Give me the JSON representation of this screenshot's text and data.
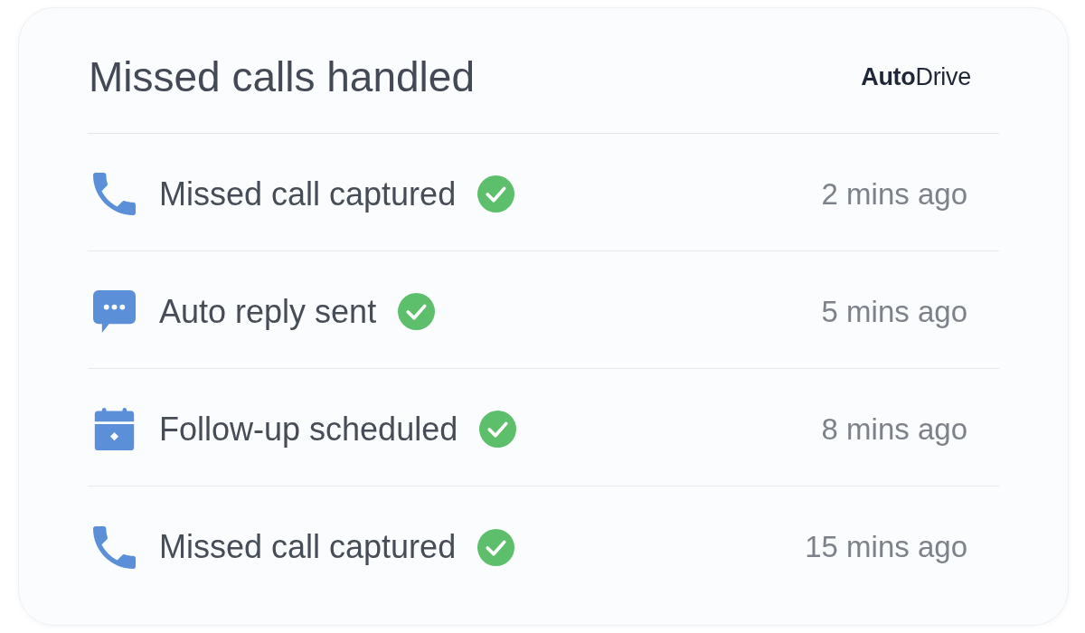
{
  "card": {
    "title": "Missed calls handled",
    "logo": "**Auto**Drive"
  },
  "events": [
    {
      "kind": "call",
      "label": "Missed call captured",
      "done": true,
      "time": "2 mins ago"
    },
    {
      "kind": "message",
      "label": "Auto reply sent",
      "done": true,
      "time": "5 mins ago"
    },
    {
      "kind": "calendar",
      "label": "Follow-up scheduled",
      "done": true,
      "time": "8 mins ago"
    },
    {
      "kind": "call",
      "label": "Missed call captured",
      "done": true,
      "time": "15 mins ago"
    }
  ]
}
